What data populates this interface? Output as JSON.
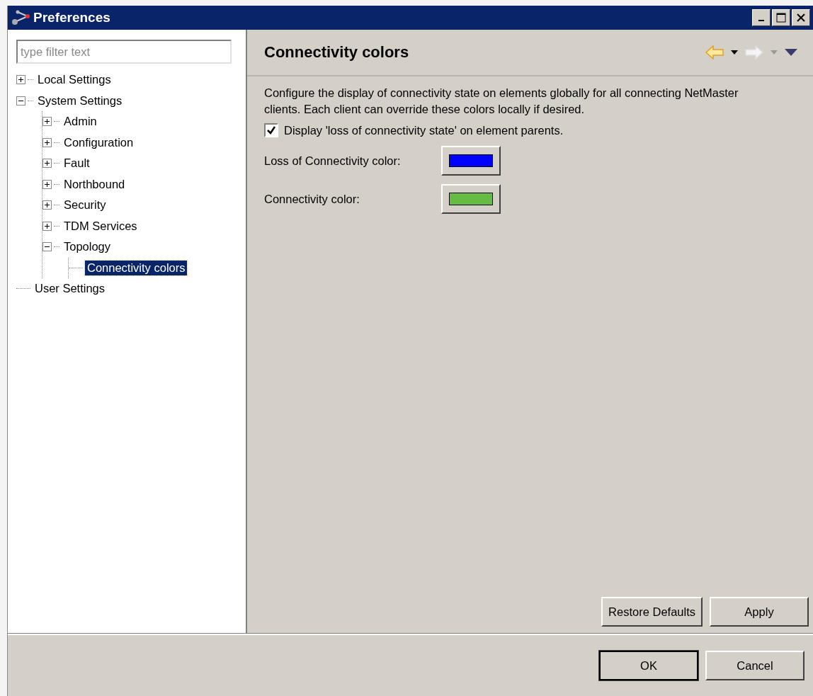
{
  "window": {
    "title": "Preferences"
  },
  "filter": {
    "placeholder": "type filter text"
  },
  "tree": [
    {
      "label": "Local Settings",
      "expanded": false,
      "selected": false
    },
    {
      "label": "System Settings",
      "expanded": true,
      "selected": false,
      "children": [
        {
          "label": "Admin",
          "expanded": false,
          "selected": false
        },
        {
          "label": "Configuration",
          "expanded": false,
          "selected": false
        },
        {
          "label": "Fault",
          "expanded": false,
          "selected": false
        },
        {
          "label": "Northbound",
          "expanded": false,
          "selected": false
        },
        {
          "label": "Security",
          "expanded": false,
          "selected": false
        },
        {
          "label": "TDM Services",
          "expanded": false,
          "selected": false
        },
        {
          "label": "Topology",
          "expanded": true,
          "selected": false,
          "children": [
            {
              "label": "Connectivity colors",
              "selected": true
            }
          ]
        }
      ]
    },
    {
      "label": "User Settings",
      "selected": false
    }
  ],
  "page": {
    "title": "Connectivity colors",
    "description": "Configure the display of connectivity state on elements globally for all connecting NetMaster clients. Each client can override these colors locally if desired.",
    "checkbox": {
      "label": "Display 'loss of connectivity state' on element parents.",
      "checked": true
    },
    "colors": [
      {
        "label": "Loss of Connectivity color:",
        "color": "#0000ff"
      },
      {
        "label": "Connectivity color:",
        "color": "#66bb44"
      }
    ],
    "buttons": [
      "Restore Defaults",
      "Apply"
    ]
  },
  "buttons": [
    "OK",
    "Cancel"
  ]
}
